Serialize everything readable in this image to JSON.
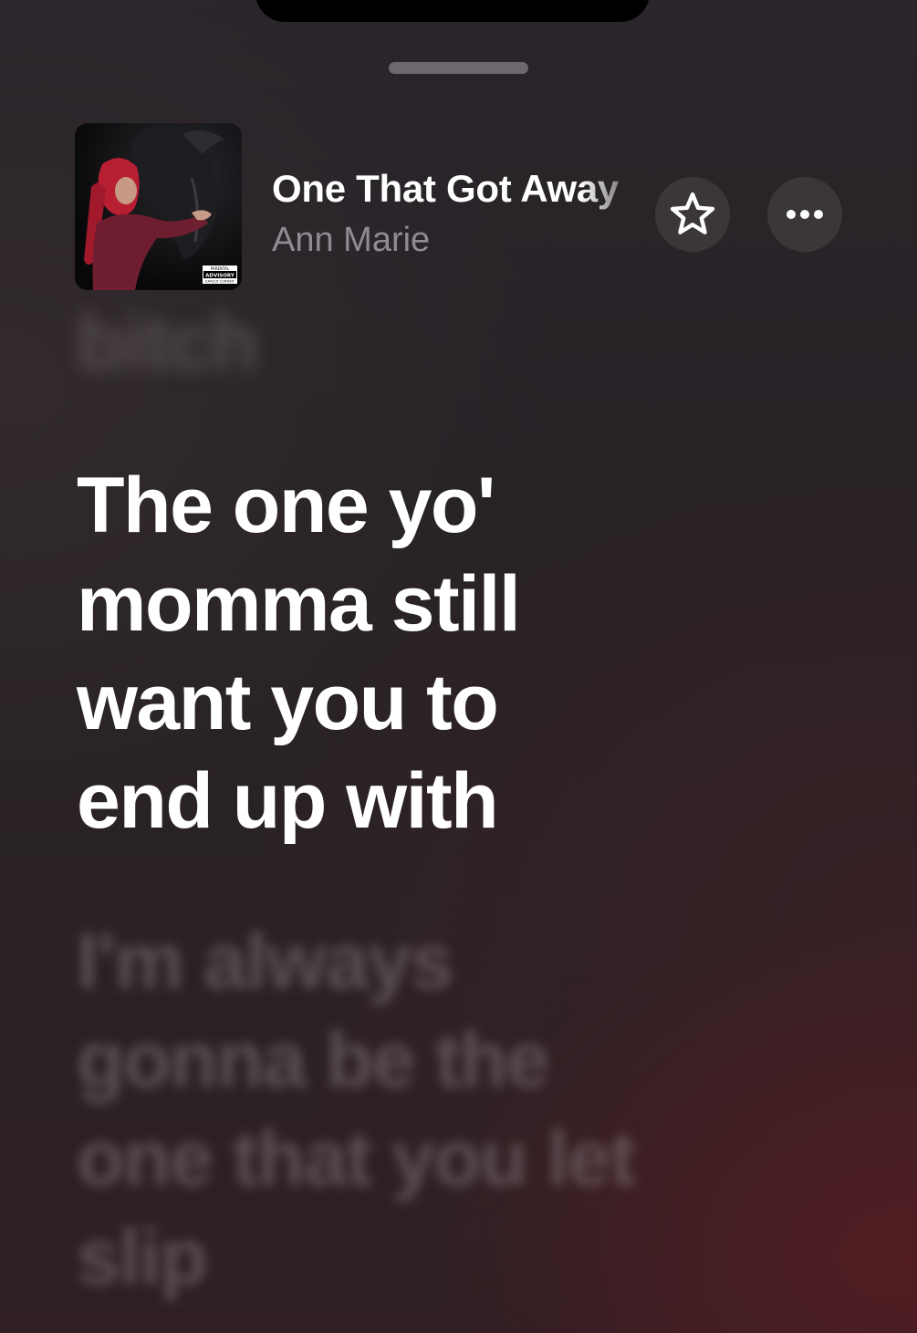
{
  "now_playing": {
    "title": "One That Got Away",
    "artist": "Ann Marie",
    "artwork": {
      "label_top": "PARENTAL",
      "label_main": "ADVISORY",
      "label_bottom": "EXPLICIT CONTENT"
    }
  },
  "actions": {
    "favorite_icon": "star-outline-icon",
    "more_icon": "ellipsis-icon"
  },
  "lyrics": {
    "previous": [
      "bitch"
    ],
    "current": [
      "The one yo'",
      "momma still",
      "want you to",
      "end up with"
    ],
    "next": [
      "I'm always",
      "gonna be the",
      "one that you let",
      "slip"
    ]
  },
  "colors": {
    "text_primary": "#ffffff",
    "text_secondary": "#8f8b90",
    "button_bg": "#3b3739"
  }
}
